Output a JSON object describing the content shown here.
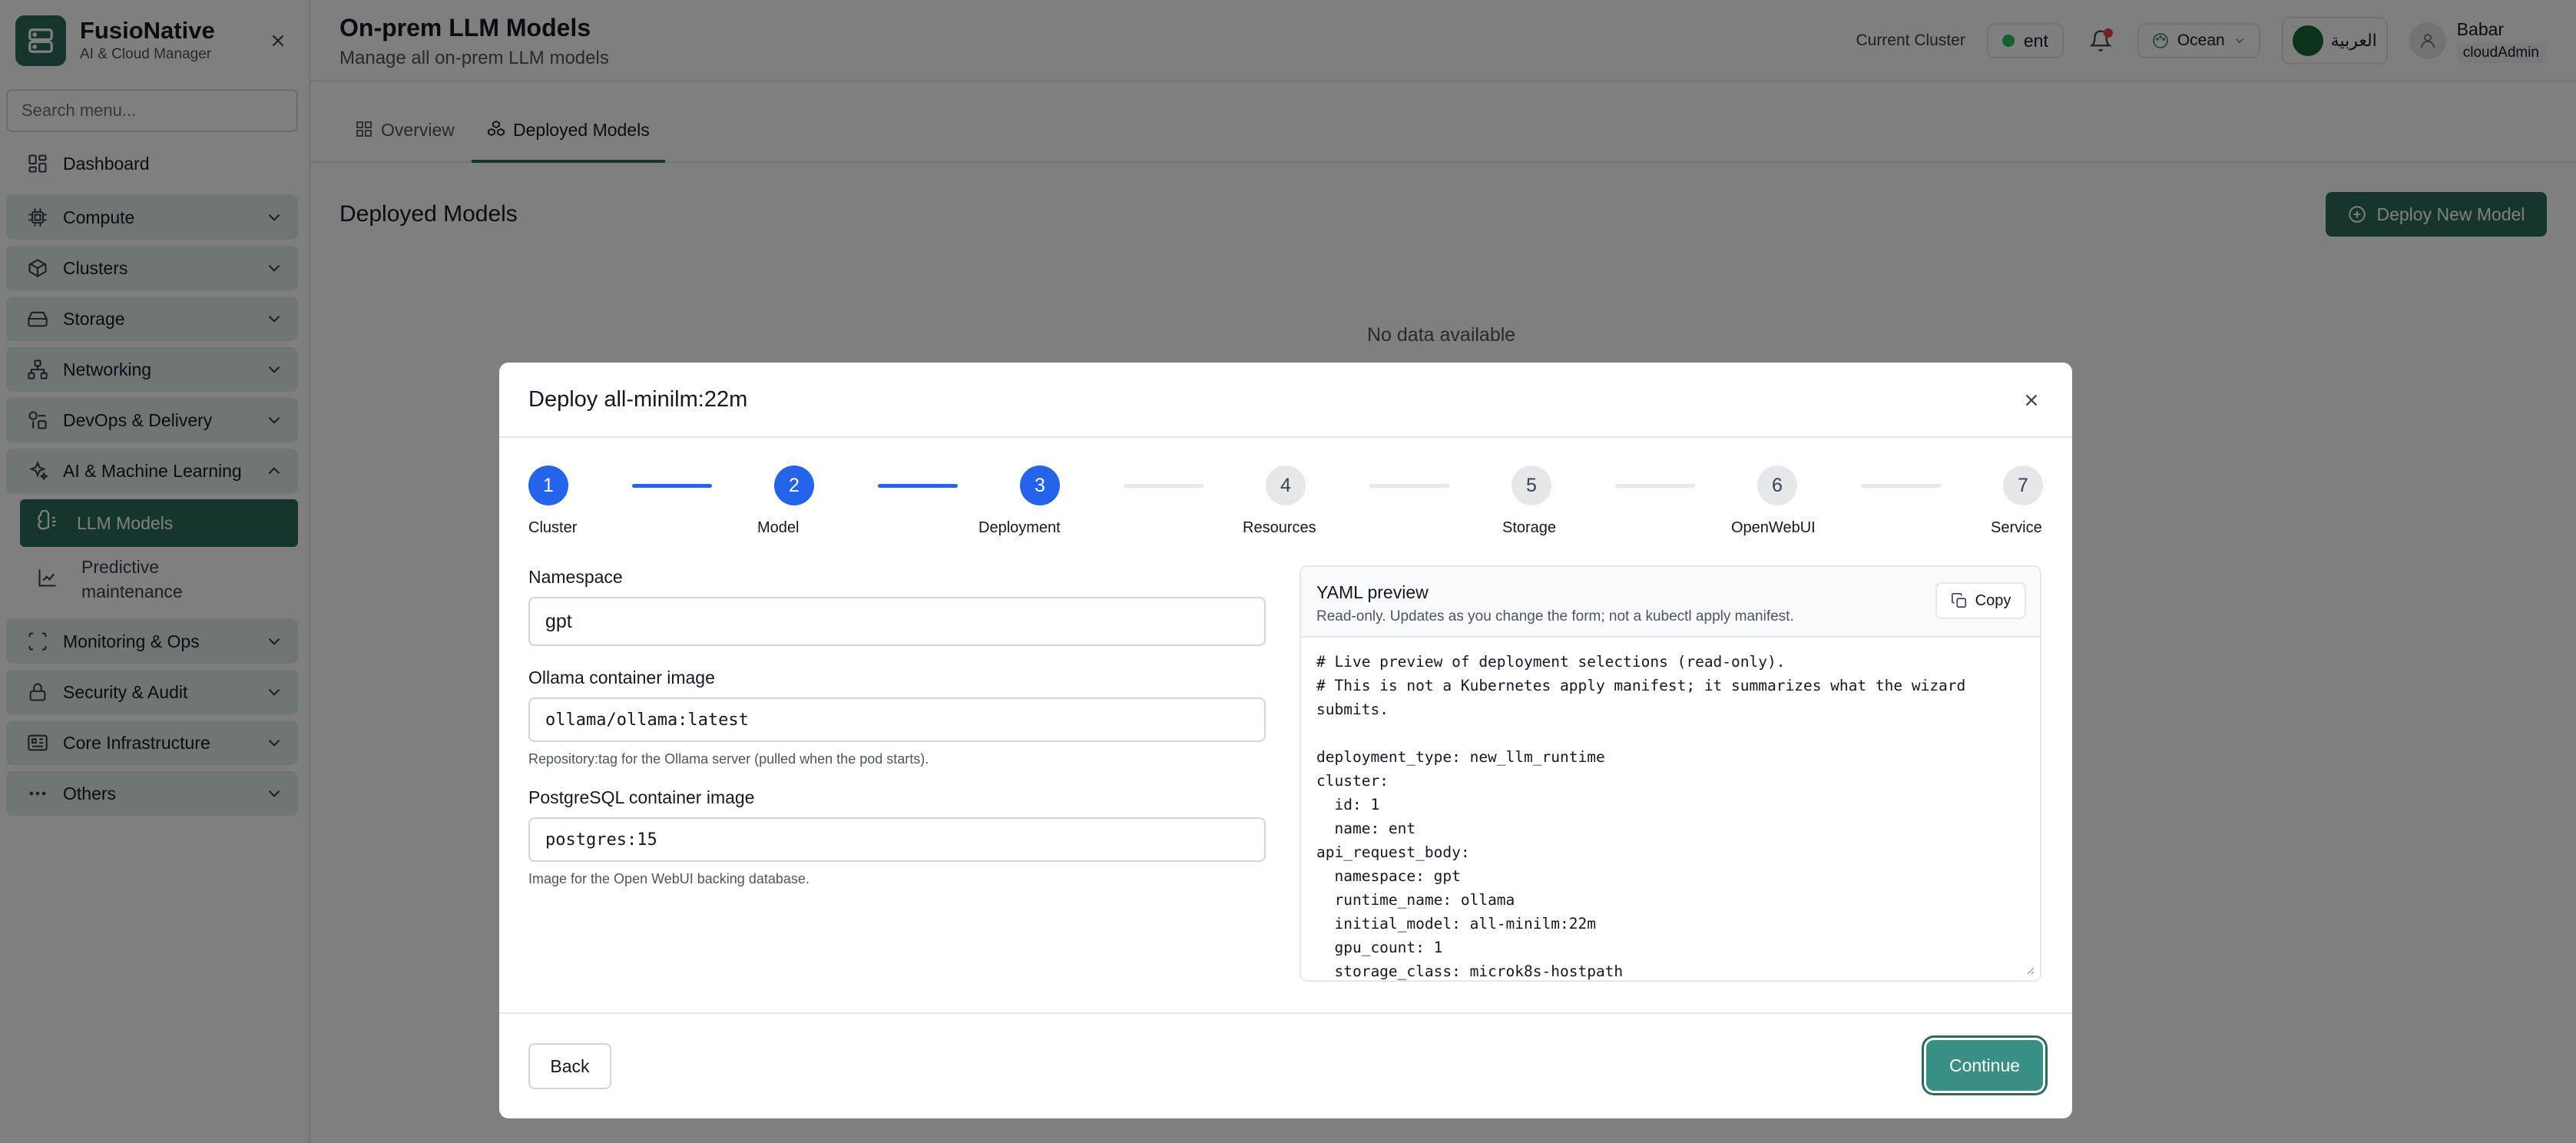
{
  "app": {
    "name": "FusioNative",
    "subtitle": "AI & Cloud Manager"
  },
  "sidebar": {
    "search_placeholder": "Search menu...",
    "dashboard": "Dashboard",
    "groups": [
      {
        "label": "Compute",
        "icon": "cpu-icon"
      },
      {
        "label": "Clusters",
        "icon": "box-icon"
      },
      {
        "label": "Storage",
        "icon": "hard-drive-icon"
      },
      {
        "label": "Networking",
        "icon": "network-icon"
      },
      {
        "label": "DevOps & Delivery",
        "icon": "shapes-icon"
      },
      {
        "label": "AI & Machine Learning",
        "icon": "sparkles-icon"
      },
      {
        "label": "Monitoring & Ops",
        "icon": "scan-icon"
      },
      {
        "label": "Security & Audit",
        "icon": "lock-icon"
      },
      {
        "label": "Core Infrastructure",
        "icon": "server-icon"
      },
      {
        "label": "Others",
        "icon": "ellipsis-icon"
      }
    ],
    "ai_items": [
      {
        "label": "LLM Models",
        "active": true
      },
      {
        "label": "Predictive",
        "label2": "maintenance",
        "active": false
      }
    ]
  },
  "header": {
    "title": "On-prem LLM Models",
    "subtitle": "Manage all on-prem LLM models",
    "cluster_label": "Current Cluster",
    "cluster_value": "ent",
    "theme": "Ocean",
    "language": "العربية",
    "user_name": "Babar",
    "user_role": "cloudAdmin"
  },
  "tabs": [
    {
      "label": "Overview"
    },
    {
      "label": "Deployed Models"
    }
  ],
  "content": {
    "section_title": "Deployed Models",
    "deploy_button": "Deploy New Model",
    "empty": "No data available"
  },
  "modal": {
    "title": "Deploy all-minilm:22m",
    "steps": [
      {
        "n": "1",
        "label": "Cluster",
        "done": true
      },
      {
        "n": "2",
        "label": "Model",
        "done": true
      },
      {
        "n": "3",
        "label": "Deployment",
        "done": true
      },
      {
        "n": "4",
        "label": "Resources",
        "done": false
      },
      {
        "n": "5",
        "label": "Storage",
        "done": false
      },
      {
        "n": "6",
        "label": "OpenWebUI",
        "done": false
      },
      {
        "n": "7",
        "label": "Service",
        "done": false
      }
    ],
    "fields": {
      "namespace_label": "Namespace",
      "namespace_value": "gpt",
      "ollama_label": "Ollama container image",
      "ollama_value": "ollama/ollama:latest",
      "ollama_help": "Repository:tag for the Ollama server (pulled when the pod starts).",
      "postgres_label": "PostgreSQL container image",
      "postgres_value": "postgres:15",
      "postgres_help": "Image for the Open WebUI backing database."
    },
    "yaml": {
      "title": "YAML preview",
      "subtitle": "Read-only. Updates as you change the form; not a kubectl apply manifest.",
      "copy": "Copy",
      "content": "# Live preview of deployment selections (read-only).\n# This is not a Kubernetes apply manifest; it summarizes what the wizard submits.\n\ndeployment_type: new_llm_runtime\ncluster:\n  id: 1\n  name: ent\napi_request_body:\n  namespace: gpt\n  runtime_name: ollama\n  initial_model: all-minilm:22m\n  gpu_count: 1\n  storage_class: microk8s-hostpath"
    },
    "back": "Back",
    "continue": "Continue"
  },
  "colors": {
    "brand": "#2d6b5e",
    "step_active": "#2563eb",
    "continue": "#3a8f84"
  }
}
